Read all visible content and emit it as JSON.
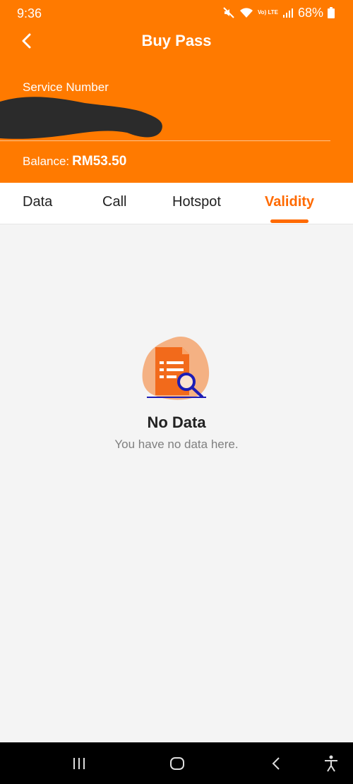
{
  "status_bar": {
    "time": "9:36",
    "battery": "68%",
    "network_label": "Vo) LTE",
    "icons": [
      "mute-icon",
      "wifi-icon",
      "volte-icon",
      "signal-icon",
      "battery-icon"
    ]
  },
  "appbar": {
    "title": "Buy Pass",
    "back_icon": "back-arrow-icon"
  },
  "account": {
    "service_label": "Service Number",
    "balance_label": "Balance:",
    "balance_value": "RM53.50"
  },
  "tabs": [
    {
      "label": "Data",
      "active": false
    },
    {
      "label": "Call",
      "active": false
    },
    {
      "label": "Hotspot",
      "active": false
    },
    {
      "label": "Validity",
      "active": true
    }
  ],
  "empty_state": {
    "icon": "document-search-icon",
    "title": "No Data",
    "message": "You have no data here."
  },
  "navbar": {
    "buttons": [
      "recents-icon",
      "home-icon",
      "back-icon",
      "accessibility-icon"
    ]
  },
  "colors": {
    "brand": "#ff7a00",
    "accent": "#ff6a00",
    "background": "#f4f4f4"
  }
}
